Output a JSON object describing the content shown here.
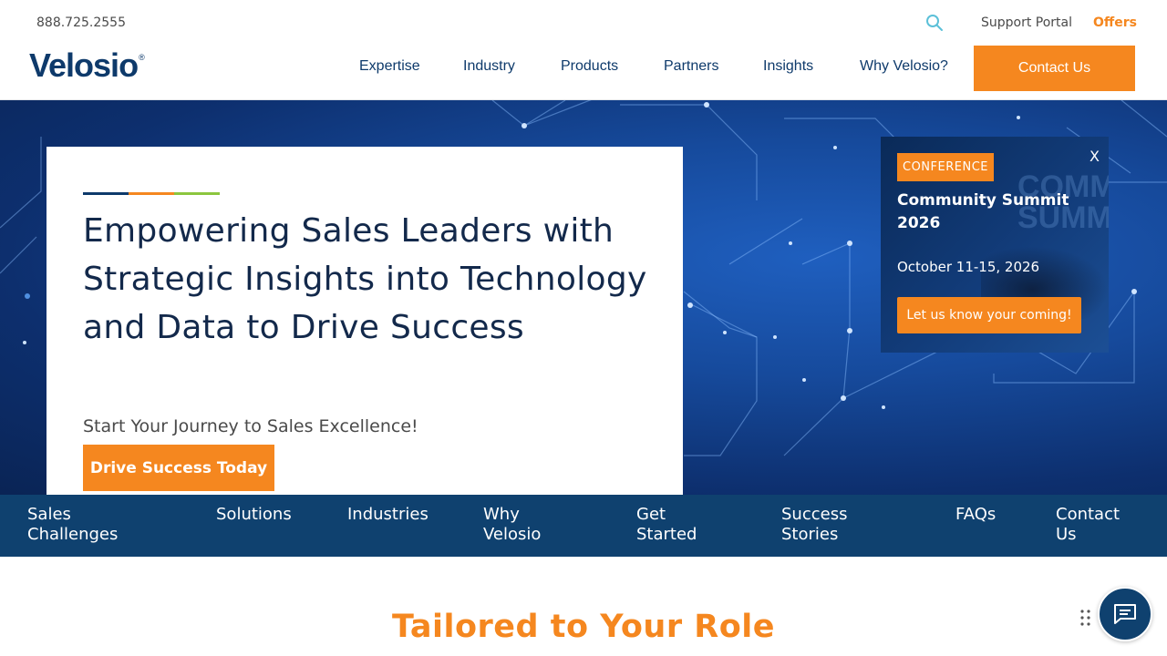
{
  "topbar": {
    "phone": "888.725.2555",
    "search_icon": "search-icon",
    "support_portal": "Support Portal",
    "offers": "Offers"
  },
  "logo": {
    "text": "Velosio",
    "mark": "®"
  },
  "nav": {
    "items": [
      "Expertise",
      "Industry",
      "Products",
      "Partners",
      "Insights",
      "Why Velosio?"
    ],
    "contact_label": "Contact Us"
  },
  "hero": {
    "accent_colors": [
      "#0e3a6b",
      "#f5871f",
      "#8cc63f"
    ],
    "title": "Empowering Sales Leaders with Strategic Insights into Technology and Data to Drive Success",
    "subtitle": "Start Your Journey to Sales Excellence!",
    "cta_label": "Drive Success Today"
  },
  "popup": {
    "close_label": "X",
    "tag": "CONFERENCE",
    "title": "Community Summit 2026",
    "date": "October 11-15, 2026",
    "cta_label": "Let us know your coming!",
    "bg_text": "COMMU SUMMI"
  },
  "subnav": {
    "items": [
      "Sales Challenges",
      "Solutions",
      "Industries",
      "Why Velosio",
      "Get Started",
      "Success Stories",
      "FAQs",
      "Contact Us"
    ]
  },
  "section": {
    "heading": "Tailored to Your Role"
  },
  "chat": {
    "icon": "chat-icon",
    "drag_icon": "drag-handle-icon"
  },
  "colors": {
    "brand_navy": "#0e3a6b",
    "brand_orange": "#f5871f",
    "brand_green": "#8cc63f",
    "subnav_bg": "#0f416f"
  }
}
